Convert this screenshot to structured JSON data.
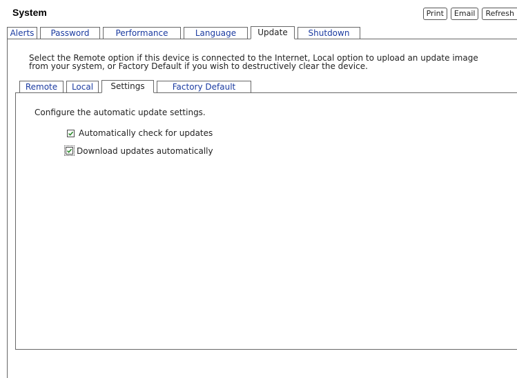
{
  "header": {
    "title": "System",
    "actions": {
      "print_label": "Print",
      "email_label": "Email",
      "refresh_label": "Refresh"
    }
  },
  "top_tabs": [
    {
      "label": "Alerts",
      "active": false
    },
    {
      "label": "Password",
      "active": false
    },
    {
      "label": "Performance",
      "active": false
    },
    {
      "label": "Language",
      "active": false
    },
    {
      "label": "Update",
      "active": true
    },
    {
      "label": "Shutdown",
      "active": false
    }
  ],
  "update": {
    "description_line1": "Select the Remote option if this device is connected to the Internet, Local option to upload an update image",
    "description_line2": "from your system, or Factory Default if you wish to destructively clear the device."
  },
  "sub_tabs": [
    {
      "label": "Remote",
      "active": false
    },
    {
      "label": "Local",
      "active": false
    },
    {
      "label": "Settings",
      "active": true
    },
    {
      "label": "Factory Default",
      "active": false
    }
  ],
  "settings": {
    "intro": "Configure the automatic update settings.",
    "options": [
      {
        "label": "Automatically check for updates",
        "checked": true
      },
      {
        "label": "Download updates automatically",
        "checked": true
      }
    ]
  },
  "colors": {
    "link_blue": "#1a3aa0",
    "check_green": "#2e8b2e",
    "border": "#666666"
  }
}
